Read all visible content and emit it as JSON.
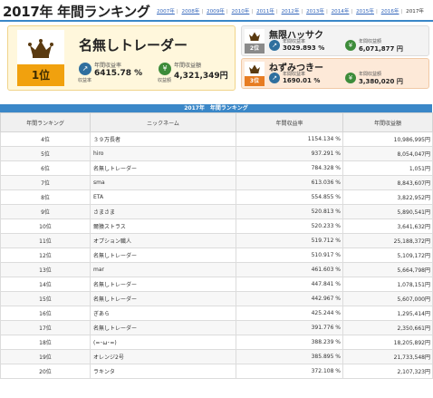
{
  "header": {
    "title": "2017年 年間ランキング",
    "years": [
      "2007年",
      "2008年",
      "2009年",
      "2010年",
      "2011年",
      "2012年",
      "2013年",
      "2014年",
      "2015年",
      "2016年"
    ],
    "current_year": "2017年"
  },
  "top3": {
    "first": {
      "rank": "1位",
      "name": "名無しトレーダー",
      "rate_caption": "年間収益率",
      "rate": "6415.78 %",
      "amount_caption": "年間収益額",
      "amount": "4,321,349円",
      "rate_icon_label": "収益率",
      "amount_icon_label": "収益額"
    },
    "second": {
      "rank": "2位",
      "name": "無限ハッサク",
      "rate_caption": "年間収益率",
      "rate": "3029.893 %",
      "amount_caption": "年間収益額",
      "amount": "6,071,877 円"
    },
    "third": {
      "rank": "3位",
      "name": "ねずみつきー",
      "rate_caption": "年間収益率",
      "rate": "1690.01 %",
      "amount_caption": "年間収益額",
      "amount": "3,380,020 円"
    }
  },
  "ranking_table": {
    "title": "2017年　年間ランキング",
    "columns": [
      "年間ランキング",
      "ニックネーム",
      "年間収益率",
      "年間収益額"
    ],
    "rows": [
      {
        "rank": "4位",
        "name": "３９万長者",
        "rate": "1154.134 %",
        "amount": "10,986,995円"
      },
      {
        "rank": "5位",
        "name": "hiro",
        "rate": "937.291 %",
        "amount": "8,054,047円"
      },
      {
        "rank": "6位",
        "name": "名無しトレーダー",
        "rate": "784.328 %",
        "amount": "1,051円"
      },
      {
        "rank": "7位",
        "name": "sma",
        "rate": "613.036 %",
        "amount": "8,843,607円"
      },
      {
        "rank": "8位",
        "name": "ETA",
        "rate": "554.855 %",
        "amount": "3,822,952円"
      },
      {
        "rank": "9位",
        "name": "さまさま",
        "rate": "520.813 %",
        "amount": "5,890,541円"
      },
      {
        "rank": "10位",
        "name": "爾猿ストラス",
        "rate": "520.233 %",
        "amount": "3,641,632円"
      },
      {
        "rank": "11位",
        "name": "オプション職人",
        "rate": "519.712 %",
        "amount": "25,188,372円"
      },
      {
        "rank": "12位",
        "name": "名無しトレーダー",
        "rate": "510.917 %",
        "amount": "5,109,172円"
      },
      {
        "rank": "13位",
        "name": "mar",
        "rate": "461.603 %",
        "amount": "5,664,798円"
      },
      {
        "rank": "14位",
        "name": "名無しトレーダー",
        "rate": "447.841 %",
        "amount": "1,078,151円"
      },
      {
        "rank": "15位",
        "name": "名無しトレーダー",
        "rate": "442.967 %",
        "amount": "5,607,000円"
      },
      {
        "rank": "16位",
        "name": "ぎあら",
        "rate": "425.244 %",
        "amount": "1,295,414円"
      },
      {
        "rank": "17位",
        "name": "名無しトレーダー",
        "rate": "391.776 %",
        "amount": "2,350,661円"
      },
      {
        "rank": "18位",
        "name": "(=･ω･=)",
        "rate": "388.239 %",
        "amount": "18,205,892円"
      },
      {
        "rank": "19位",
        "name": "オレンジ2号",
        "rate": "385.895 %",
        "amount": "21,733,548円"
      },
      {
        "rank": "20位",
        "name": "ラキンタ",
        "rate": "372.108 %",
        "amount": "2,107,323円"
      }
    ]
  },
  "colors": {
    "accent_blue": "#3a87c8",
    "gold": "#f1a10e",
    "silver": "#8a8a8a",
    "bronze": "#e77c22",
    "crown": "#5a3a10"
  },
  "icons": {
    "crown": "crown-icon",
    "rate": "rate-icon",
    "amount": "yen-icon"
  }
}
